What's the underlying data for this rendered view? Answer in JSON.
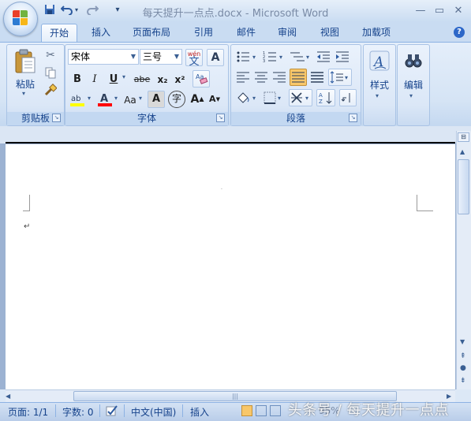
{
  "window": {
    "title": "每天提升一点点.docx - Microsoft Word",
    "controls": [
      "minimize",
      "maximize",
      "close"
    ]
  },
  "quick_access": [
    "save-icon",
    "undo-icon",
    "redo-icon",
    "customize-icon"
  ],
  "tabs": [
    {
      "label": "开始",
      "active": true
    },
    {
      "label": "插入"
    },
    {
      "label": "页面布局"
    },
    {
      "label": "引用"
    },
    {
      "label": "邮件"
    },
    {
      "label": "审阅"
    },
    {
      "label": "视图"
    },
    {
      "label": "加载项"
    }
  ],
  "ribbon": {
    "clipboard": {
      "group_label": "剪贴板",
      "paste_label": "粘贴"
    },
    "font": {
      "group_label": "字体",
      "font_name": "宋体",
      "font_size": "三号",
      "bold": "B",
      "italic": "I",
      "underline": "U",
      "strikethrough": "abe",
      "subscript": "x₂",
      "superscript": "x²",
      "change_case": "Aa",
      "grow_font": "A",
      "shrink_font": "A",
      "char_border": "A",
      "enclose_char": "字",
      "phonetic_top": "wén",
      "phonetic_char": "文"
    },
    "paragraph": {
      "group_label": "段落"
    },
    "styles": {
      "label": "样式"
    },
    "editing": {
      "label": "编辑"
    }
  },
  "document": {
    "paragraph_mark": "↵"
  },
  "statusbar": {
    "page": "页面: 1/1",
    "words": "字数: 0",
    "language": "中文(中国)",
    "mode": "插入",
    "zoom": "95%"
  },
  "watermark": "头条号 / 每天提升一点点",
  "colors": {
    "ribbon_bg": "#dbe7f7",
    "accent": "#15428b",
    "highlight": "#ffff00",
    "font_color": "#ff0000",
    "active_align": "#f8c76a"
  }
}
